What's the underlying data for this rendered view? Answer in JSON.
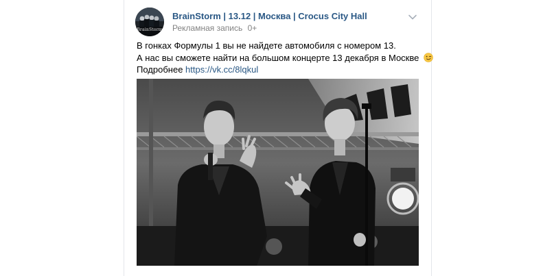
{
  "post": {
    "author": "BrainStorm | 13.12 | Москва | Crocus City Hall",
    "ad_label": "Рекламная запись",
    "age_rating": "0+",
    "text_line_1": "В гонках Формулы 1 вы не найдете автомобиля с номером 13.",
    "text_line_2": "А нас вы сможете найти на большом концерте 13 декабря в Москве",
    "text_more": "Подробнее",
    "link": "https://vk.cc/8lqkul",
    "avatar_text": "BrainStorm",
    "emoji": "winking-face",
    "colors": {
      "link": "#2a5885",
      "muted": "#828282",
      "text": "#000000"
    }
  }
}
